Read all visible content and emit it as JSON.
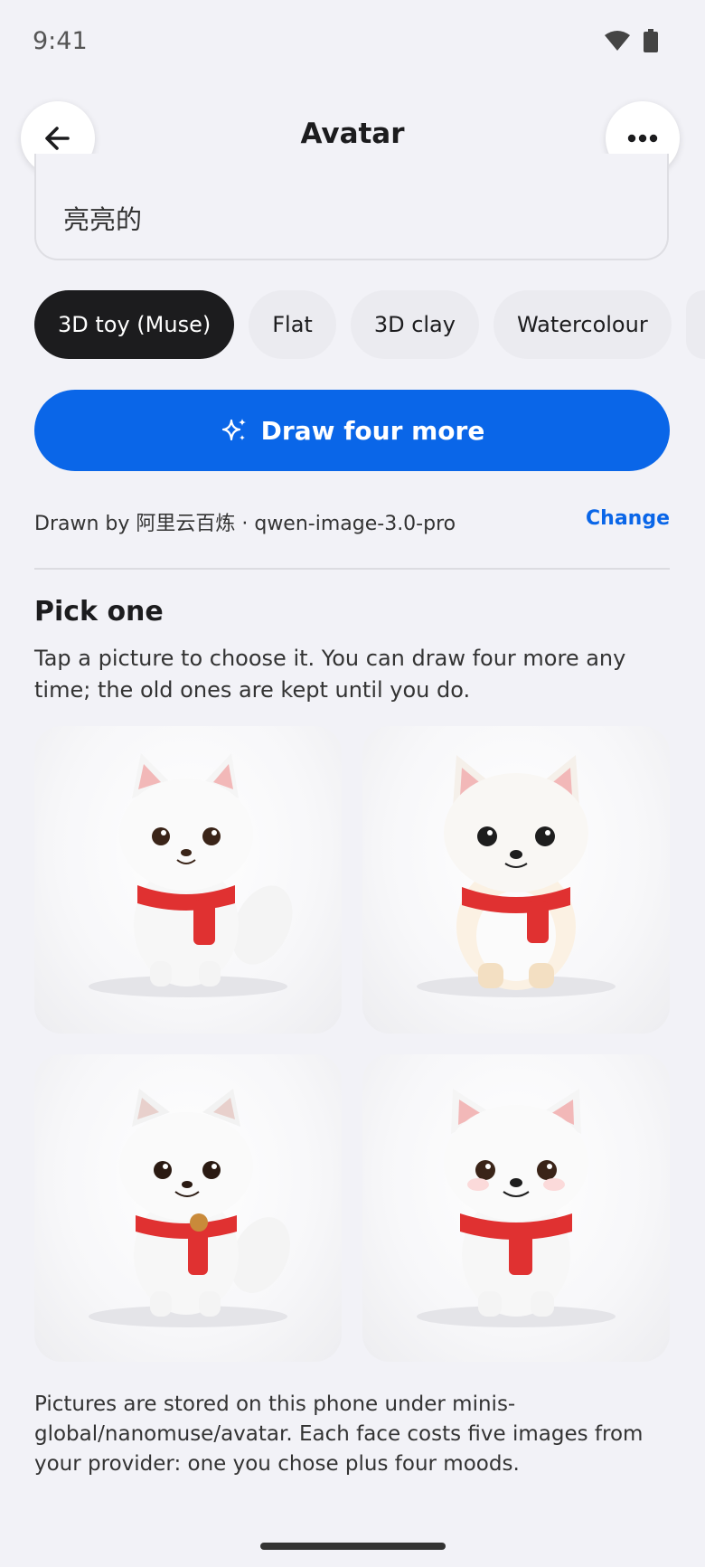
{
  "status": {
    "time": "9:41"
  },
  "header": {
    "title": "Avatar"
  },
  "prompt": {
    "text": "亮亮的"
  },
  "styles": {
    "items": [
      "3D toy (Muse)",
      "Flat",
      "3D clay",
      "Watercolour"
    ],
    "selected": "3D toy (Muse)"
  },
  "actions": {
    "draw_label": "Draw four more"
  },
  "provider": {
    "text": "Drawn by 阿里云百炼 · qwen-image-3.0-pro",
    "change_label": "Change"
  },
  "pick": {
    "title": "Pick one",
    "description": "Tap a picture to choose it. You can draw four more any time; the old ones are kept until you do."
  },
  "footer": {
    "note": "Pictures are stored on this phone under minis-global/nanomuse/avatar. Each face costs five images from your provider: one you chose plus four moods."
  },
  "colors": {
    "accent": "#0a66e8",
    "chip_active": "#1c1c1e",
    "scarf": "#e03131"
  },
  "icons": {
    "back": "arrow-left-icon",
    "more": "more-horizontal-icon",
    "draw": "sparkles-icon"
  }
}
